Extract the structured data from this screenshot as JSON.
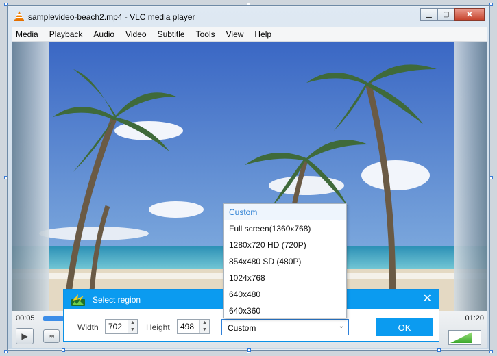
{
  "window": {
    "title": "samplevideo-beach2.mp4 - VLC media player",
    "minimize": "▁",
    "maximize": "▢",
    "close": "✕"
  },
  "menu": [
    "Media",
    "Playback",
    "Audio",
    "Video",
    "Subtitle",
    "Tools",
    "View",
    "Help"
  ],
  "player": {
    "elapsed": "00:05",
    "duration": "01:20",
    "progress_fraction": 0.06,
    "volume_fraction": 0.72,
    "play_icon": "play-icon",
    "prev_icon": "skip-back-icon"
  },
  "dialog": {
    "title": "Select region",
    "close": "✕",
    "width_label": "Width",
    "width_value": "702",
    "height_label": "Height",
    "height_value": "498",
    "preset_selected": "Custom",
    "ok_label": "OK"
  },
  "dropdown": {
    "options": [
      "Custom",
      "Full screen(1360x768)",
      "1280x720 HD (720P)",
      "854x480 SD (480P)",
      "1024x768",
      "640x480",
      "640x360"
    ],
    "selected_index": 0
  },
  "colors": {
    "accent": "#0b9bf0",
    "sky": "#3f6fc7"
  }
}
